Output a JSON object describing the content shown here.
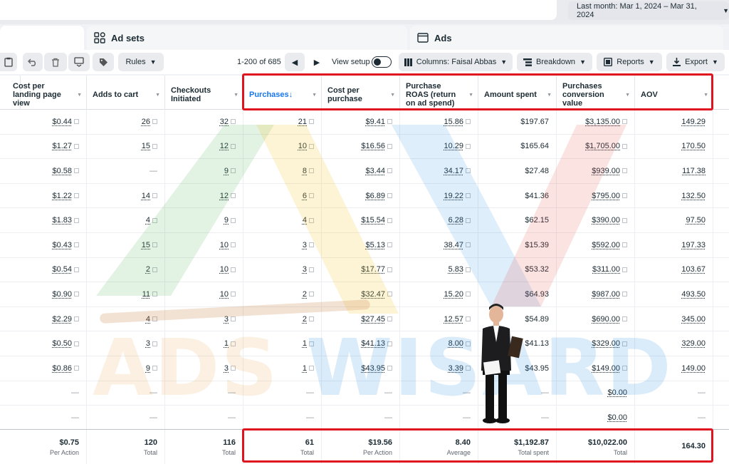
{
  "date_range": {
    "label": "Last month: Mar 1, 2024 – Mar 31, 2024"
  },
  "tabs": {
    "adsets": "Ad sets",
    "ads": "Ads"
  },
  "toolbar": {
    "rules": "Rules",
    "pager": "1-200 of 685",
    "view_setup": "View setup",
    "columns": "Columns: Faisal Abbas",
    "breakdown": "Breakdown",
    "reports": "Reports",
    "export": "Export"
  },
  "columns": [
    "Cost per landing page view",
    "Adds to cart",
    "Checkouts Initiated",
    "Purchases",
    "Cost per purchase",
    "Purchase ROAS (return on ad spend)",
    "Amount spent",
    "Purchases conversion value",
    "AOV"
  ],
  "rows": [
    [
      "$0.44",
      "26",
      "32",
      "21",
      "$9.41",
      "15.86",
      "$197.67",
      "$3,135.00",
      "149.29"
    ],
    [
      "$1.27",
      "15",
      "12",
      "10",
      "$16.56",
      "10.29",
      "$165.64",
      "$1,705.00",
      "170.50"
    ],
    [
      "$0.58",
      "—",
      "9",
      "8",
      "$3.44",
      "34.17",
      "$27.48",
      "$939.00",
      "117.38"
    ],
    [
      "$1.22",
      "14",
      "12",
      "6",
      "$6.89",
      "19.22",
      "$41.36",
      "$795.00",
      "132.50"
    ],
    [
      "$1.83",
      "4",
      "9",
      "4",
      "$15.54",
      "6.28",
      "$62.15",
      "$390.00",
      "97.50"
    ],
    [
      "$0.43",
      "15",
      "10",
      "3",
      "$5.13",
      "38.47",
      "$15.39",
      "$592.00",
      "197.33"
    ],
    [
      "$0.54",
      "2",
      "10",
      "3",
      "$17.77",
      "5.83",
      "$53.32",
      "$311.00",
      "103.67"
    ],
    [
      "$0.90",
      "11",
      "10",
      "2",
      "$32.47",
      "15.20",
      "$64.93",
      "$987.00",
      "493.50"
    ],
    [
      "$2.29",
      "4",
      "3",
      "2",
      "$27.45",
      "12.57",
      "$54.89",
      "$690.00",
      "345.00"
    ],
    [
      "$0.50",
      "3",
      "1",
      "1",
      "$41.13",
      "8.00",
      "$41.13",
      "$329.00",
      "329.00"
    ],
    [
      "$0.86",
      "9",
      "3",
      "1",
      "$43.95",
      "3.39",
      "$43.95",
      "$149.00",
      "149.00"
    ],
    [
      "—",
      "—",
      "—",
      "—",
      "—",
      "—",
      "—",
      "$0.00",
      "—"
    ],
    [
      "—",
      "—",
      "—",
      "—",
      "—",
      "—",
      "—",
      "$0.00",
      "—"
    ]
  ],
  "totals": [
    {
      "value": "$0.75",
      "label": "Per Action"
    },
    {
      "value": "120",
      "label": "Total"
    },
    {
      "value": "116",
      "label": "Total"
    },
    {
      "value": "61",
      "label": "Total"
    },
    {
      "value": "$19.56",
      "label": "Per Action"
    },
    {
      "value": "8.40",
      "label": "Average"
    },
    {
      "value": "$1,192.87",
      "label": "Total spent"
    },
    {
      "value": "$10,022.00",
      "label": "Total"
    },
    {
      "value": "164.30",
      "label": ""
    }
  ],
  "watermark": {
    "text": "ADS WISARD",
    "colors": [
      "#e8a64a",
      "#4caf50",
      "#1e88e5",
      "#e53935"
    ]
  },
  "colors": {
    "highlight": "#e0141e",
    "active_sort": "#1877f2"
  }
}
